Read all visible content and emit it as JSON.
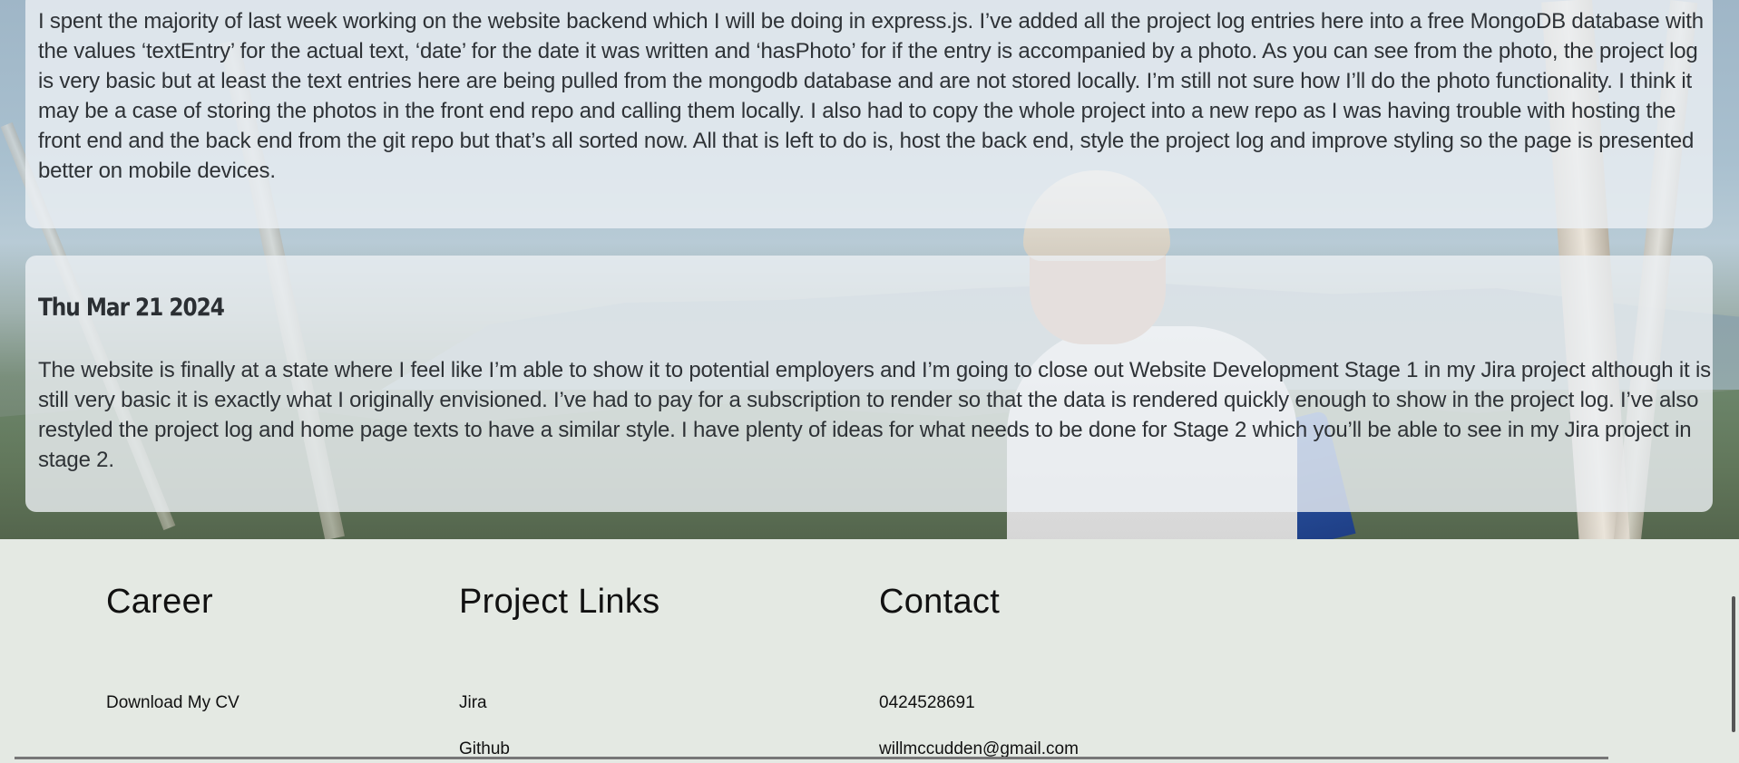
{
  "entries": [
    {
      "date": "",
      "text": "I spent the majority of last week working on the website backend which I will be doing in express.js. I’ve added all the project log entries here into a free MongoDB database with the values ‘textEntry’ for the actual text, ‘date’ for the date it was written and ‘hasPhoto’ for if the entry is accompanied by a photo. As you can see from the photo, the project log is very basic but at least the text entries here are being pulled from the mongodb database and are not stored locally. I’m still not sure how I’ll do the photo functionality. I think it may be a case of storing the photos in the front end repo and calling them locally. I also had to copy the whole project into a new repo as I was having trouble with hosting the front end and the back end from the git repo but that’s all sorted now. All that is left to do is, host the back end, style the project log and improve styling so the page is presented better on mobile devices."
    },
    {
      "date": "Thu Mar 21 2024",
      "text": "The website is finally at a state where I feel like I’m able to show it to potential employers and I’m going to close out Website Development Stage 1 in my Jira project although it is still very basic it is exactly what I originally envisioned. I’ve had to pay for a subscription to render so that the data is rendered quickly enough to show in the project log. I’ve also restyled the project log and home page texts to have a similar style. I have plenty of ideas for what needs to be done for Stage 2 which you’ll be able to see in my Jira project in stage 2."
    }
  ],
  "footer": {
    "career": {
      "heading": "Career",
      "links": [
        "Download My CV"
      ]
    },
    "project_links": {
      "heading": "Project Links",
      "links": [
        "Jira",
        "Github"
      ]
    },
    "contact": {
      "heading": "Contact",
      "phone": "0424528691",
      "email": "willmccudden@gmail.com"
    }
  },
  "colors": {
    "card_bg": "#ecf0f4",
    "footer_bg": "#e4e9e3",
    "text": "#2e3236"
  }
}
